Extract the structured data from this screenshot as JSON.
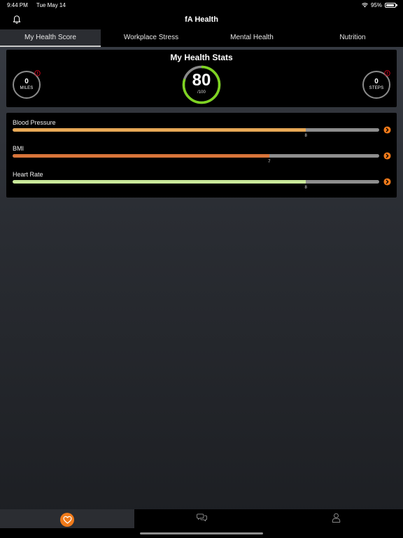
{
  "status": {
    "time": "9:44 PM",
    "date": "Tue May 14",
    "battery": "95%",
    "battery_level": 0.95
  },
  "header": {
    "title": "fA Health"
  },
  "tabs": [
    {
      "label": "My Health Score",
      "active": true
    },
    {
      "label": "Workplace Stress",
      "active": false
    },
    {
      "label": "Mental Health",
      "active": false
    },
    {
      "label": "Nutrition",
      "active": false
    }
  ],
  "stats": {
    "title": "My Health Stats",
    "miles": {
      "value": "0",
      "unit": "MILES"
    },
    "steps": {
      "value": "0",
      "unit": "STEPS"
    },
    "score": {
      "value": "80",
      "max_label": "/100",
      "fraction": 0.8,
      "ring_color": "#7ed321",
      "track_color": "#8a8a8a"
    },
    "alert_color": "#d0021b"
  },
  "metrics": [
    {
      "label": "Blood Pressure",
      "value": "8",
      "fraction": 0.8,
      "color": "#e8a956"
    },
    {
      "label": "BMI",
      "value": "7",
      "fraction": 0.7,
      "color": "#d8743a"
    },
    {
      "label": "Heart Rate",
      "value": "8",
      "fraction": 0.8,
      "color": "#c9e89a"
    }
  ],
  "colors": {
    "accent": "#f07a1a",
    "track": "#8e8e8e"
  },
  "bottom_nav": [
    {
      "icon": "heart-icon",
      "active": true
    },
    {
      "icon": "chat-icon",
      "active": false
    },
    {
      "icon": "profile-icon",
      "active": false
    }
  ]
}
